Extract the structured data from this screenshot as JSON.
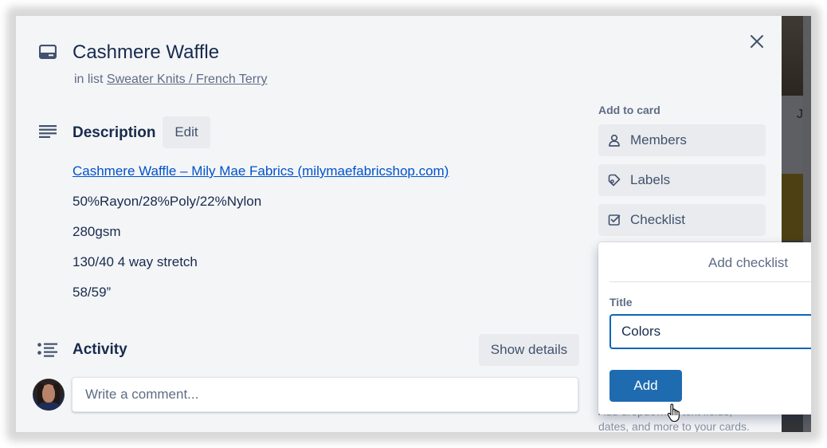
{
  "card": {
    "title": "Cashmere Waffle",
    "in_list_prefix": "in list",
    "list_name": "Sweater Knits / French Terry",
    "close_icon": "close-icon",
    "card_icon": "card-icon"
  },
  "description": {
    "heading": "Description",
    "edit_label": "Edit",
    "link_text": "Cashmere Waffle – Mily Mae Fabrics (milymaefabricshop.com)",
    "lines": [
      "50%Rayon/28%Poly/22%Nylon",
      "280gsm",
      "130/40 4 way stretch",
      "58/59”"
    ]
  },
  "activity": {
    "heading": "Activity",
    "show_details_label": "Show details",
    "comment_placeholder": "Write a comment..."
  },
  "sidebar": {
    "heading": "Add to card",
    "items": [
      {
        "label": "Members",
        "icon": "member-icon"
      },
      {
        "label": "Labels",
        "icon": "label-icon"
      },
      {
        "label": "Checklist",
        "icon": "checklist-icon"
      }
    ],
    "obscured_text": [
      "Add dropdowns, text fields,",
      "dates, and more to your cards."
    ]
  },
  "popover": {
    "title": "Add checklist",
    "field_label": "Title",
    "field_value": "Colors",
    "add_label": "Add"
  },
  "background": {
    "partial_letter": "J"
  },
  "colors": {
    "primary_button": "#1f6bb0",
    "input_focus_border": "#0c66b8",
    "link": "#0052cc",
    "text_primary": "#172b4d",
    "text_secondary": "#5e6c84",
    "modal_bg": "#f4f5f7",
    "button_bg": "#e9ebee"
  }
}
